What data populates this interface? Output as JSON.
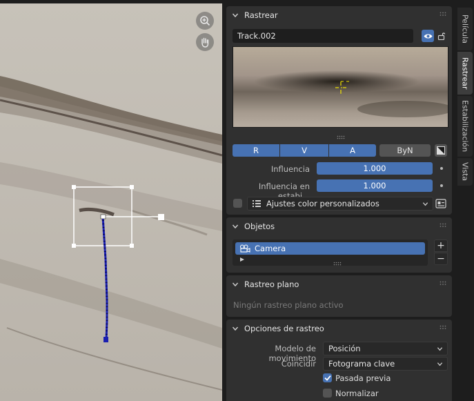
{
  "colors": {
    "accent": "#4772b3",
    "panel": "#303030",
    "track_path": "#1a1fb0"
  },
  "viewport": {
    "zoom_icon": "zoom-in-icon",
    "pan_icon": "hand-icon"
  },
  "panels": {
    "track": {
      "title": "Rastrear",
      "name_value": "Track.002",
      "channels": [
        "R",
        "V",
        "A"
      ],
      "byn_label": "ByN",
      "influence_label": "Influencia",
      "influence_value": "1.000",
      "stab_influence_label": "Influencia en estabi...",
      "stab_influence_value": "1.000",
      "color_preset": "Ajustes color personalizados"
    },
    "objects": {
      "title": "Objetos",
      "items": [
        "Camera"
      ],
      "add_label": "+",
      "remove_label": "−"
    },
    "plane": {
      "title": "Rastreo plano",
      "empty_text": "Ningún rastreo plano activo"
    },
    "options": {
      "title": "Opciones de rastreo",
      "motion_model_label": "Modelo de movimiento",
      "motion_model_value": "Posición",
      "match_label": "Coincidir",
      "match_value": "Fotograma clave",
      "prepass_label": "Pasada previa",
      "prepass_checked": true,
      "normalize_label": "Normalizar",
      "normalize_checked": false
    }
  },
  "tabs": [
    "Película",
    "Rastrear",
    "Estabilización",
    "Vista"
  ],
  "active_tab": "Rastrear"
}
